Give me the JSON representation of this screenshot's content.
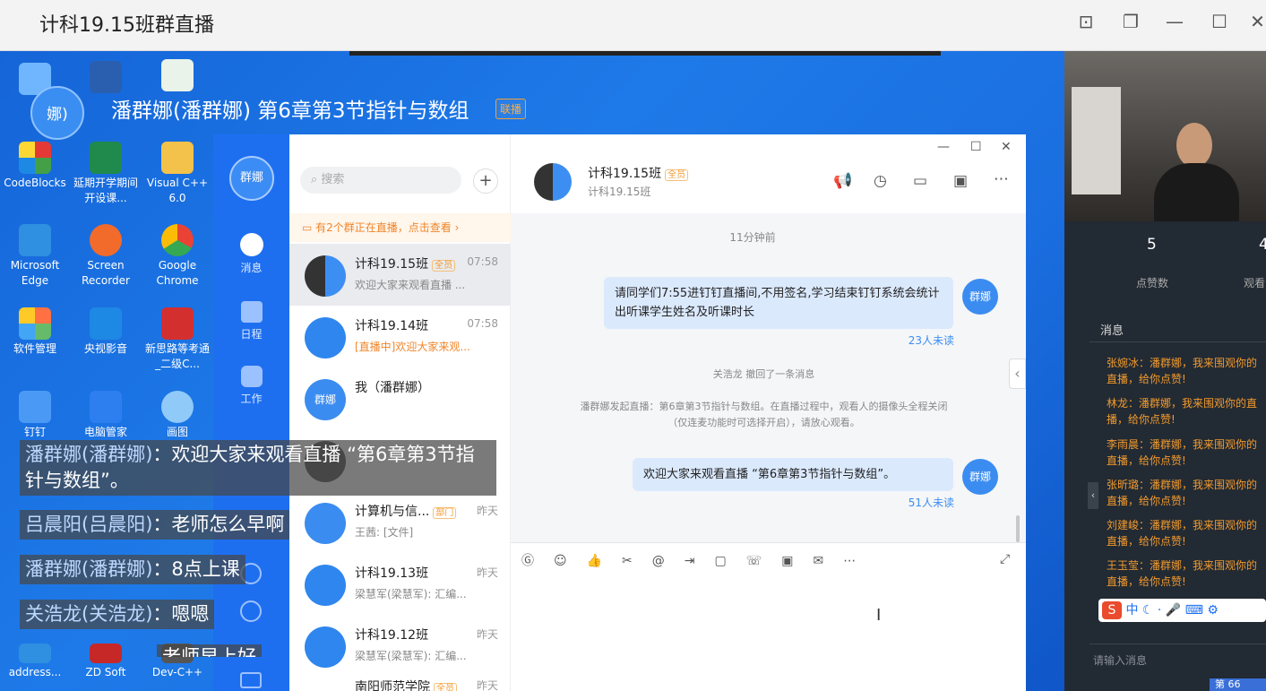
{
  "window": {
    "title": "计科19.15班群直播"
  },
  "live": {
    "avatar_text": "娜)",
    "title": "潘群娜(潘群娜) 第6章第3节指针与数组",
    "badge": "联播"
  },
  "desktop_icons": [
    {
      "label": "CodeBlocks"
    },
    {
      "label": "延期开学期间开设课..."
    },
    {
      "label": "Visual C++ 6.0"
    },
    {
      "label": "Microsoft Edge"
    },
    {
      "label": "Screen Recorder"
    },
    {
      "label": "Google Chrome"
    },
    {
      "label": "软件管理"
    },
    {
      "label": "央视影音"
    },
    {
      "label": "新思路等考通_二级C..."
    },
    {
      "label": "钉钉"
    },
    {
      "label": "电脑管家"
    },
    {
      "label": "画图"
    },
    {
      "label": "address..."
    },
    {
      "label": "ZD Soft"
    },
    {
      "label": "Dev-C++"
    }
  ],
  "nav": {
    "avatar": "群娜",
    "items": [
      {
        "label": "消息"
      },
      {
        "label": "日程"
      },
      {
        "label": "工作"
      }
    ]
  },
  "list": {
    "search_placeholder": "搜索",
    "live_notice": "有2个群正在直播，点击查看",
    "conversations": [
      {
        "name": "计科19.15班",
        "tag": "全员",
        "time": "07:58",
        "preview": "欢迎大家来观看直播 ..."
      },
      {
        "name": "计科19.14班",
        "tag": "",
        "time": "07:58",
        "preview": "[直播中]欢迎大家来观..."
      },
      {
        "name": "我（潘群娜）",
        "tag": "",
        "time": "",
        "preview": ""
      },
      {
        "name": "",
        "tag": "",
        "time": "",
        "preview": ""
      },
      {
        "name": "计算机与信...",
        "tag": "部门",
        "time": "昨天",
        "preview": "王茜: [文件]"
      },
      {
        "name": "计科19.13班",
        "tag": "",
        "time": "昨天",
        "preview": "梁慧军(梁慧军): 汇编..."
      },
      {
        "name": "计科19.12班",
        "tag": "",
        "time": "昨天",
        "preview": "梁慧军(梁慧军): 汇编..."
      },
      {
        "name": "南阳师范学院",
        "tag": "全员",
        "time": "昨天",
        "preview": ""
      }
    ]
  },
  "chat": {
    "group_name": "计科19.15班",
    "group_tag": "全员",
    "group_sub": "计科19.15班",
    "time_divider": "11分钟前",
    "msg1": "请同学们7:55进钉钉直播间,不用签名,学习结束钉钉系统会统计出听课学生姓名及听课时长",
    "msg1_unread": "23人未读",
    "recall": "关浩龙 撤回了一条消息",
    "system": "潘群娜发起直播：第6章第3节指针与数组。在直播过程中，观看人的摄像头全程关闭（仅连麦功能时可选择开启），请放心观看。",
    "msg2": "欢迎大家来观看直播 “第6章第3节指针与数组”。",
    "msg2_unread": "51人未读",
    "sender_avatar": "群娜"
  },
  "comments": [
    {
      "who": "潘群娜(潘群娜)",
      "text": "：欢迎大家来观看直播 “第6章第3节指针与数组”。"
    },
    {
      "who": "吕晨阳(吕晨阳)",
      "text": "：老师怎么早啊"
    },
    {
      "who": "潘群娜(潘群娜)",
      "text": "：8点上课"
    },
    {
      "who": "关浩龙(关浩龙)",
      "text": "：嗯嗯"
    },
    {
      "who": "",
      "text": "老师早上好"
    }
  ],
  "stats": {
    "likes": "5",
    "likes_label": "点赞数",
    "watch_label": "观看"
  },
  "panel": {
    "messages_title": "消息",
    "input_placeholder": "请输入消息",
    "messages": [
      "张婉冰：潘群娜，我来围观你的直播，给你点赞!",
      "林龙：潘群娜，我来围观你的直播，给你点赞!",
      "李雨晨：潘群娜，我来围观你的直播，给你点赞!",
      "张昕璐：潘群娜，我来围观你的直播，给你点赞!",
      "刘建峻：潘群娜，我来围观你的直播，给你点赞!",
      "王玉莹：潘群娜，我来围观你的直播，给你点赞!"
    ],
    "ime": "中",
    "corner": "第 66"
  }
}
